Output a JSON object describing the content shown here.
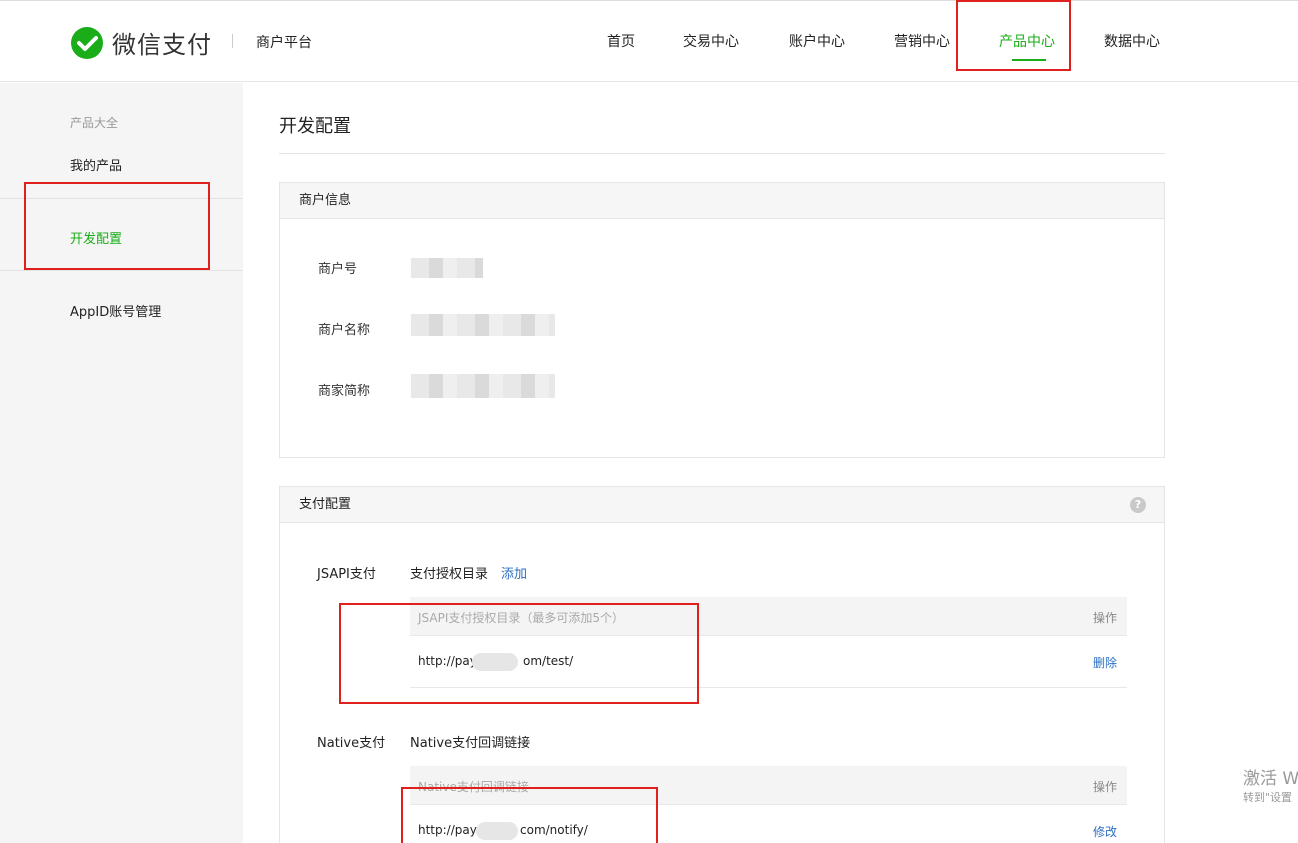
{
  "brand": {
    "logo_text": "微信支付",
    "platform": "商户平台",
    "accent": "#1aad19"
  },
  "nav": {
    "home": "首页",
    "trade": "交易中心",
    "account": "账户中心",
    "marketing": "营销中心",
    "product": "产品中心",
    "data": "数据中心",
    "active": "产品中心"
  },
  "sidebar": {
    "category": "产品大全",
    "items": [
      "我的产品",
      "开发配置",
      "AppID账号管理"
    ],
    "active": "开发配置"
  },
  "page": {
    "title": "开发配置"
  },
  "merchant_info": {
    "header": "商户信息",
    "fields": [
      {
        "label": "商户号"
      },
      {
        "label": "商户名称"
      },
      {
        "label": "商家简称"
      }
    ]
  },
  "pay_config": {
    "header": "支付配置",
    "help": "?",
    "jsapi": {
      "label": "JSAPI支付",
      "sub_label": "支付授权目录",
      "add": "添加",
      "table_header": "JSAPI支付授权目录（最多可添加5个）",
      "action_header": "操作",
      "rows": [
        {
          "url_start": "http://pay",
          "url_end": "om/test/",
          "action": "删除"
        }
      ]
    },
    "native": {
      "label": "Native支付",
      "sub_label": "Native支付回调链接",
      "table_header": "Native支付回调链接",
      "action_header": "操作",
      "rows": [
        {
          "url_start": "http://pay.r",
          "url_end": "com/notify/",
          "action": "修改"
        }
      ]
    }
  },
  "watermark": {
    "line1": "激活 W",
    "line2": "转到\"设置"
  },
  "colors": {
    "accent_green": "#1aad19",
    "link_blue": "#2b6fc2",
    "highlight_red": "#e0201d"
  }
}
